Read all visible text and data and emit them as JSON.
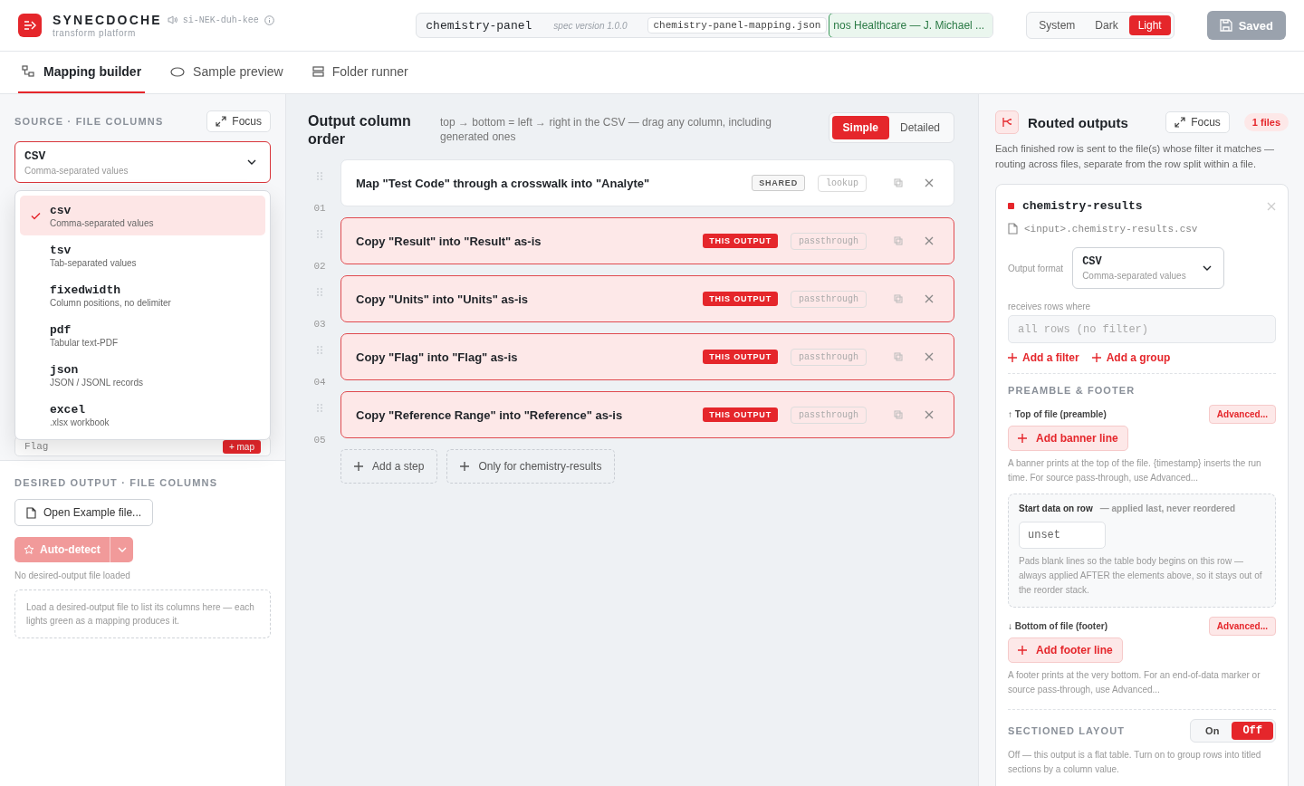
{
  "app": {
    "name": "SYNECDOCHE",
    "subtitle": "transform platform",
    "pronunciation": "si-NEK-duh-kee"
  },
  "spec": {
    "name": "chemistry-panel",
    "version": "spec version 1.0.0",
    "file": "chemistry-panel-mapping.json",
    "client": "nos Healthcare — J. Michael ..."
  },
  "theme": [
    {
      "label": "System",
      "selected": false
    },
    {
      "label": "Dark",
      "selected": false
    },
    {
      "label": "Light",
      "selected": true
    }
  ],
  "save_button": {
    "label": "Saved",
    "disabled": true
  },
  "tabs": [
    {
      "label": "Mapping builder",
      "selected": true
    },
    {
      "label": "Sample preview",
      "selected": false
    },
    {
      "label": "Folder runner",
      "selected": false
    }
  ],
  "source": {
    "title": "SOURCE · FILE COLUMNS",
    "focus": "Focus",
    "format": {
      "value": "CSV",
      "description": "Comma-separated values"
    },
    "format_menu": [
      {
        "value": "csv",
        "description": "Comma-separated values",
        "selected": true
      },
      {
        "value": "tsv",
        "description": "Tab-separated values",
        "selected": false
      },
      {
        "value": "fixedwidth",
        "description": "Column positions, no delimiter",
        "selected": false
      },
      {
        "value": "pdf",
        "description": "Tabular text-PDF",
        "selected": false
      },
      {
        "value": "json",
        "description": "JSON / JSONL records",
        "selected": false
      },
      {
        "value": "excel",
        "description": ".xlsx workbook",
        "selected": false
      }
    ],
    "columns": [
      {
        "name": "Flag",
        "action": "+ map"
      }
    ]
  },
  "desired": {
    "title": "DESIRED OUTPUT · FILE COLUMNS",
    "open_button": "Open Example file...",
    "autodetect": {
      "label": "Auto-detect",
      "disabled": true
    },
    "status": "No desired-output file loaded",
    "hint": "Load a desired-output file to list its columns here — each lights green as a mapping produces it."
  },
  "order": {
    "title": "Output column order",
    "hint": "top → bottom = left → right in the CSV — drag any column, including generated ones",
    "modes": [
      {
        "label": "Simple",
        "selected": true
      },
      {
        "label": "Detailed",
        "selected": false
      }
    ],
    "steps": [
      {
        "number": "01",
        "text": "Map \"Test Code\" through a crosswalk into \"Analyte\"",
        "kind": "shared",
        "scope": "SHARED",
        "op": "lookup"
      },
      {
        "number": "02",
        "text": "Copy \"Result\" into \"Result\" as-is",
        "kind": "this",
        "scope": "THIS OUTPUT",
        "op": "passthrough"
      },
      {
        "number": "03",
        "text": "Copy \"Units\" into \"Units\" as-is",
        "kind": "this",
        "scope": "THIS OUTPUT",
        "op": "passthrough"
      },
      {
        "number": "04",
        "text": "Copy \"Flag\" into \"Flag\" as-is",
        "kind": "this",
        "scope": "THIS OUTPUT",
        "op": "passthrough"
      },
      {
        "number": "05",
        "text": "Copy \"Reference Range\" into \"Reference\" as-is",
        "kind": "this",
        "scope": "THIS OUTPUT",
        "op": "passthrough"
      }
    ],
    "add_buttons": [
      "Add a step",
      "Only for chemistry-results"
    ]
  },
  "routed": {
    "title": "Routed outputs",
    "focus": "Focus",
    "count": "1 files",
    "description": "Each finished row is sent to the file(s) whose filter it matches — routing across files, separate from the row split within a file.",
    "output": {
      "name": "chemistry-results",
      "color": "#e5262b",
      "path": "<input>.chemistry-results.csv",
      "format_label": "Output format",
      "format": {
        "value": "CSV",
        "description": "Comma-separated values"
      },
      "filter_label": "receives rows where",
      "filter_placeholder": "all rows (no filter)",
      "filter_actions": [
        "Add a filter",
        "Add a group"
      ],
      "preamble_title": "PREAMBLE & FOOTER",
      "top_label": "↑ Top of file (preamble)",
      "top_advanced": "Advanced...",
      "banner_button": "Add banner line",
      "banner_hint": "A banner prints at the top of the file. {timestamp} inserts the run time. For source pass-through, use Advanced...",
      "start": {
        "label": "Start data on row",
        "note": "— applied last, never reordered",
        "placeholder": "unset",
        "hint": "Pads blank lines so the table body begins on this row — always applied AFTER the elements above, so it stays out of the reorder stack."
      },
      "bottom_label": "↓ Bottom of file (footer)",
      "bottom_advanced": "Advanced...",
      "footer_button": "Add footer line",
      "footer_hint": "A footer prints at the very bottom. For an end-of-data marker or source pass-through, use Advanced...",
      "sectioned_title": "SECTIONED LAYOUT",
      "sectioned_options": [
        {
          "label": "On",
          "selected": false
        },
        {
          "label": "Off",
          "selected": true
        }
      ],
      "sectioned_hint": "Off — this output is a flat table. Turn on to group rows into titled sections by a column value."
    }
  }
}
